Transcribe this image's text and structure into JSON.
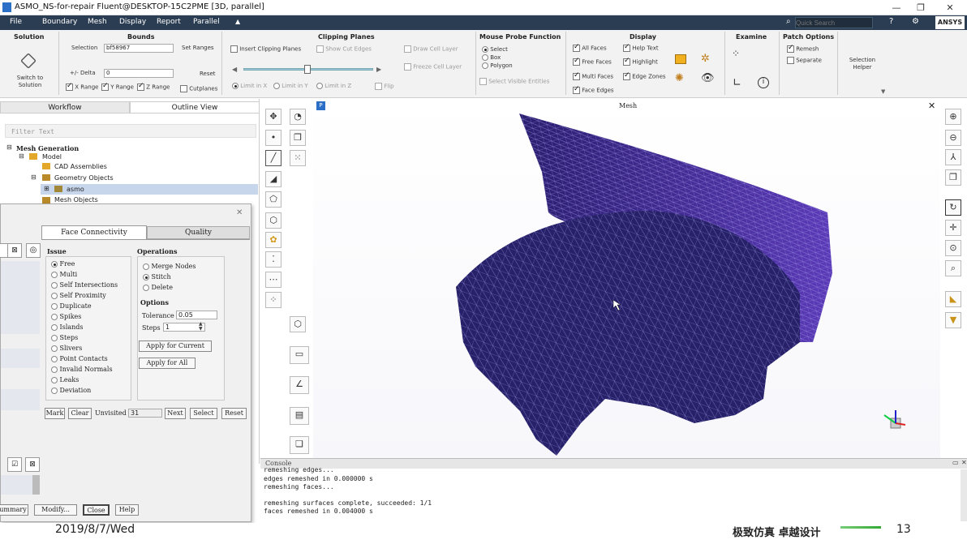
{
  "window": {
    "title": "ASMO_NS-for-repair Fluent@DESKTOP-15C2PME  [3D, parallel]",
    "minimize": "—",
    "maximize": "❐",
    "close": "✕"
  },
  "menubar": {
    "items": [
      "File",
      "Boundary",
      "Mesh",
      "Display",
      "Report",
      "Parallel"
    ],
    "search_placeholder": "Quick Search",
    "brand": "ANSYS"
  },
  "ribbon": {
    "solution": {
      "title": "Solution",
      "switch_label": "Switch to Solution"
    },
    "bounds": {
      "title": "Bounds",
      "selection_label": "Selection",
      "selection_value": "bf58967",
      "set_ranges": "Set Ranges",
      "delta_label": "+/- Delta",
      "delta_value": "0",
      "reset": "Reset",
      "x_range": "X Range",
      "y_range": "Y Range",
      "z_range": "Z Range",
      "cutplanes": "Cutplanes"
    },
    "clipping": {
      "title": "Clipping Planes",
      "insert": "Insert Clipping Planes",
      "show_cut_edges": "Show Cut Edges",
      "draw_cell_layer": "Draw Cell Layer",
      "freeze_cell_layer": "Freeze Cell Layer",
      "limit_x": "Limit in X",
      "limit_y": "Limit in Y",
      "limit_z": "Limit in Z",
      "flip": "Flip"
    },
    "probe": {
      "title": "Mouse Probe Function",
      "select": "Select",
      "box": "Box",
      "polygon": "Polygon",
      "select_visible": "Select Visible Entities"
    },
    "display": {
      "title": "Display",
      "all_faces": "All Faces",
      "free_faces": "Free Faces",
      "multi_faces": "Multi Faces",
      "face_edges": "Face Edges",
      "help_text": "Help Text",
      "highlight": "Highlight",
      "edge_zones": "Edge Zones"
    },
    "examine": {
      "title": "Examine"
    },
    "patch": {
      "title": "Patch Options",
      "remesh": "Remesh",
      "separate": "Separate"
    },
    "selection_helper": "Selection Helper"
  },
  "leftpanel": {
    "tab_workflow": "Workflow",
    "tab_outline": "Outline View",
    "filter_placeholder": "Filter Text",
    "tree": {
      "mesh_generation": "Mesh Generation",
      "model": "Model",
      "cad_assemblies": "CAD Assemblies",
      "geometry_objects": "Geometry Objects",
      "asmo": "asmo",
      "mesh_objects": "Mesh Objects"
    }
  },
  "dialog": {
    "tab_connectivity": "Face Connectivity",
    "tab_quality": "Quality",
    "issue_title": "Issue",
    "issues": [
      "Free",
      "Multi",
      "Self Intersections",
      "Self Proximity",
      "Duplicate",
      "Spikes",
      "Islands",
      "Steps",
      "Slivers",
      "Point Contacts",
      "Invalid Normals",
      "Leaks",
      "Deviation"
    ],
    "operations_title": "Operations",
    "operations": [
      "Merge Nodes",
      "Stitch",
      "Delete"
    ],
    "options_title": "Options",
    "tolerance_label": "Tolerance",
    "tolerance_value": "0.05",
    "steps_label": "Steps",
    "steps_value": "1",
    "apply_current": "Apply for Current",
    "apply_all": "Apply for All",
    "mark": "Mark",
    "clear": "Clear",
    "unvisited_label": "Unvisited",
    "unvisited_value": "31",
    "next": "Next",
    "select": "Select",
    "reset": "Reset",
    "summary": "ummary",
    "modify": "Modify...",
    "close": "Close",
    "help": "Help"
  },
  "viewport": {
    "title": "Mesh",
    "badge": "P"
  },
  "console": {
    "title": "Console",
    "lines": [
      "remeshing edges...",
      "edges remeshed in 0.000000 s",
      "remeshing faces...",
      "",
      "remeshing surfaces complete, succeeded: 1/1",
      "faces remeshed in 0.004000 s"
    ]
  },
  "footer": {
    "date": "2019/8/7/Wed",
    "slogan": "极致仿真 卓越设计",
    "page": "13"
  },
  "colors": {
    "menubar": "#2b3d52",
    "mesh_dark": "#2a1e6e",
    "mesh_light": "#5b3ab8"
  }
}
